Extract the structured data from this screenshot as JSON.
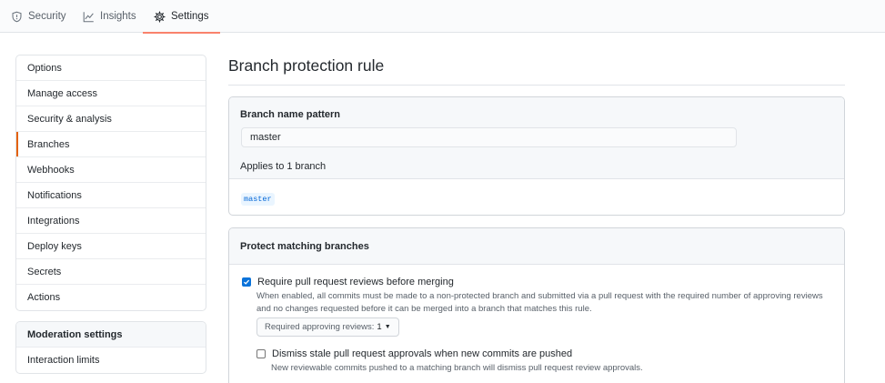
{
  "topnav": {
    "tabs": [
      {
        "label": "Security",
        "icon": "shield-icon",
        "selected": false
      },
      {
        "label": "Insights",
        "icon": "graph-icon",
        "selected": false
      },
      {
        "label": "Settings",
        "icon": "gear-icon",
        "selected": true
      }
    ]
  },
  "sidebar": {
    "items": [
      {
        "label": "Options"
      },
      {
        "label": "Manage access"
      },
      {
        "label": "Security & analysis"
      },
      {
        "label": "Branches",
        "selected": true
      },
      {
        "label": "Webhooks"
      },
      {
        "label": "Notifications"
      },
      {
        "label": "Integrations"
      },
      {
        "label": "Deploy keys"
      },
      {
        "label": "Secrets"
      },
      {
        "label": "Actions"
      }
    ],
    "moderation": {
      "heading": "Moderation settings",
      "items": [
        {
          "label": "Interaction limits"
        }
      ]
    }
  },
  "main": {
    "title": "Branch protection rule",
    "pattern": {
      "label": "Branch name pattern",
      "value": "master",
      "applies": "Applies to 1 branch",
      "branch": "master"
    },
    "protect": {
      "heading": "Protect matching branches",
      "require_reviews": {
        "label": "Require pull request reviews before merging",
        "checked": true,
        "note": "When enabled, all commits must be made to a non-protected branch and submitted via a pull request with the required number of approving reviews and no changes requested before it can be merged into a branch that matches this rule."
      },
      "approving_select": {
        "label": "Required approving reviews:",
        "value": "1"
      },
      "dismiss_stale": {
        "label": "Dismiss stale pull request approvals when new commits are pushed",
        "checked": false,
        "note": "New reviewable commits pushed to a matching branch will dismiss pull request review approvals."
      }
    }
  },
  "colors": {
    "accent_underline": "#f9826c",
    "selected_sidebar": "#e36209",
    "checkbox_blue": "#0b73da",
    "branch_chip": "#0366d6"
  }
}
